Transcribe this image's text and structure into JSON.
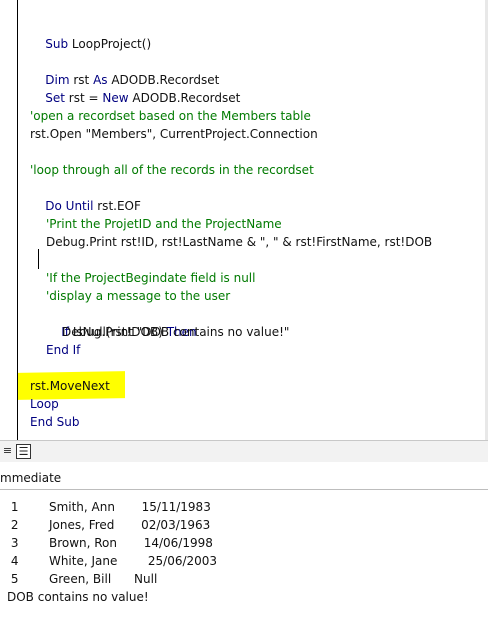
{
  "code": {
    "sub_kw": "Sub",
    "sub_name": " LoopProject()",
    "dim_kw": "Dim",
    "dim_rest": " rst ",
    "dim_as": "As",
    "dim_type": " ADODB.Recordset",
    "set_kw": "Set",
    "set_rest": " rst = ",
    "set_new": "New",
    "set_type": " ADODB.Recordset",
    "comment_open": "'open a recordset based on the Members table",
    "open_stmt": "rst.Open \"Members\", CurrentProject.Connection",
    "comment_loop": "'loop through all of the records in the recordset",
    "do_kw": "Do Until",
    "do_rest": " rst.EOF",
    "comment_print": "'Print the ProjetID and the ProjectName",
    "debug_print": "Debug.Print rst!ID, rst!LastName & \", \" & rst!FirstName, rst!DOB",
    "comment_if1": "'If the ProjectBegindate field is null",
    "comment_if2": "'display a message to the user",
    "if_kw": "If",
    "if_rest": " IsNull(rst!DOB) ",
    "then_kw": "Then",
    "debug_msg": "Debug.Print \"DOB contains no value!\"",
    "endif_kw": "End If",
    "movenext": "rst.MoveNext",
    "loop_kw": "Loop",
    "endsub_kw": "End Sub"
  },
  "view_bar": {
    "procedure_view_icon": "procedure-view-icon",
    "full_module_view_icon": "full-module-view-icon"
  },
  "immediate": {
    "title": "mmediate",
    "lines": [
      " 1        Smith, Ann       15/11/1983",
      " 2        Jones, Fred       02/03/1963",
      " 3        Brown, Ron       14/06/1998",
      " 4        White, Jane        25/06/2003",
      " 5        Green, Bill      Null",
      "DOB contains no value!"
    ]
  },
  "colors": {
    "keyword": "#000080",
    "comment": "#007a00",
    "highlight": "#ffff00"
  }
}
